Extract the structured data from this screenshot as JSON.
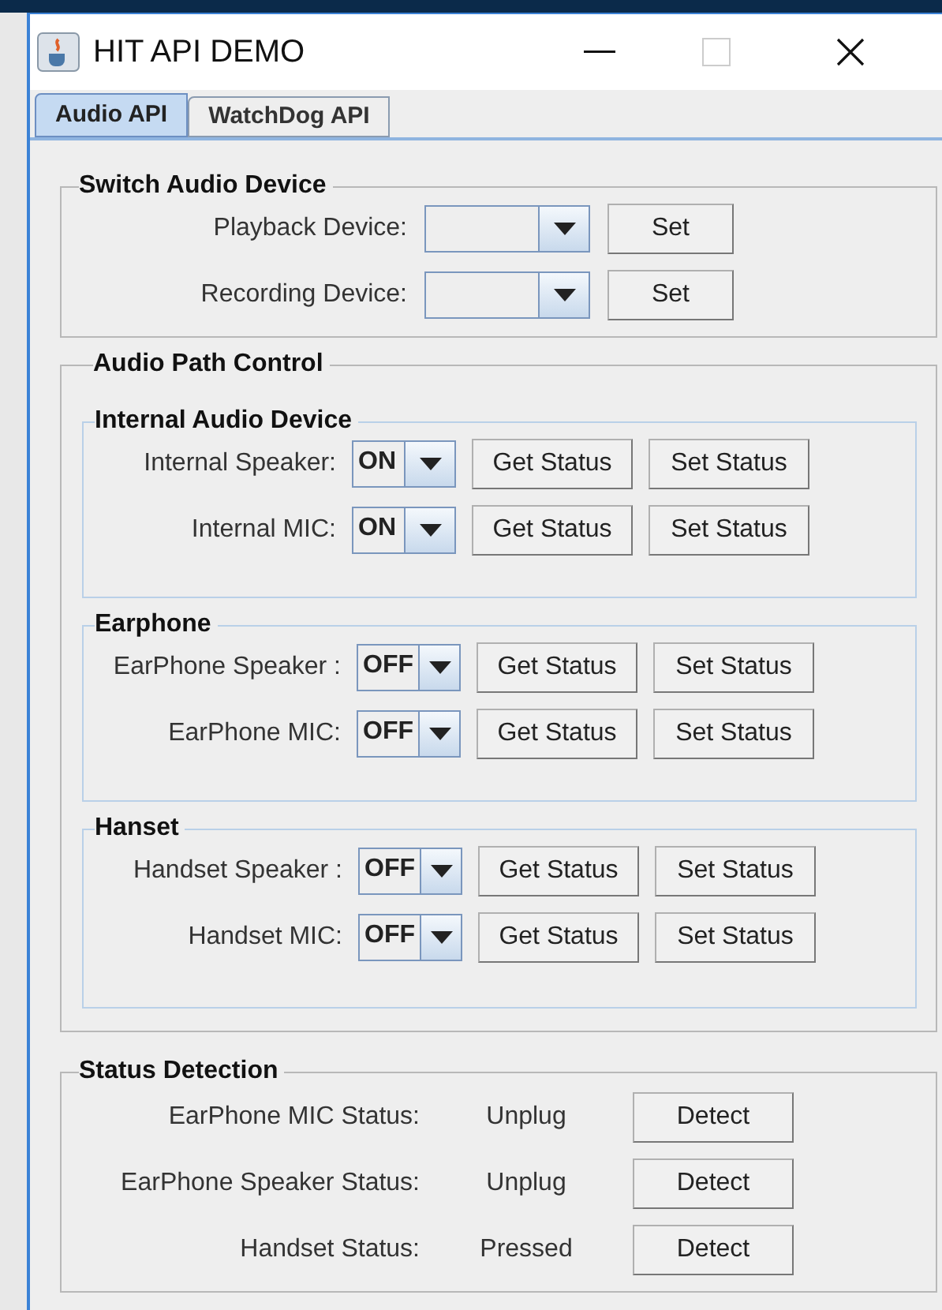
{
  "window": {
    "title": "HIT API DEMO"
  },
  "tabs": [
    {
      "label": "Audio API",
      "selected": true
    },
    {
      "label": "WatchDog API",
      "selected": false
    }
  ],
  "switch_audio_device": {
    "title": "Switch Audio Device",
    "rows": [
      {
        "label": "Playback Device:",
        "button": "Set"
      },
      {
        "label": "Recording Device:",
        "button": "Set"
      }
    ]
  },
  "audio_path_control": {
    "title": "Audio Path Control",
    "groups": [
      {
        "title": "Internal Audio Device",
        "rows": [
          {
            "label": "Internal Speaker:",
            "value": "ON",
            "buttons": [
              "Get Status",
              "Set Status"
            ]
          },
          {
            "label": "Internal MIC:",
            "value": "ON",
            "buttons": [
              "Get Status",
              "Set Status"
            ]
          }
        ]
      },
      {
        "title": "Earphone",
        "rows": [
          {
            "label": "EarPhone Speaker :",
            "value": "OFF",
            "buttons": [
              "Get Status",
              "Set Status"
            ]
          },
          {
            "label": "EarPhone MIC:",
            "value": "OFF",
            "buttons": [
              "Get Status",
              "Set Status"
            ]
          }
        ]
      },
      {
        "title": "Hanset",
        "rows": [
          {
            "label": "Handset Speaker :",
            "value": "OFF",
            "buttons": [
              "Get Status",
              "Set Status"
            ]
          },
          {
            "label": "Handset MIC:",
            "value": "OFF",
            "buttons": [
              "Get Status",
              "Set Status"
            ]
          }
        ]
      }
    ]
  },
  "status_detection": {
    "title": "Status Detection",
    "rows": [
      {
        "label": "EarPhone MIC Status:",
        "status": "Unplug",
        "button": "Detect"
      },
      {
        "label": "EarPhone Speaker Status:",
        "status": "Unplug",
        "button": "Detect"
      },
      {
        "label": "Handset Status:",
        "status": "Pressed",
        "button": "Detect"
      }
    ]
  }
}
